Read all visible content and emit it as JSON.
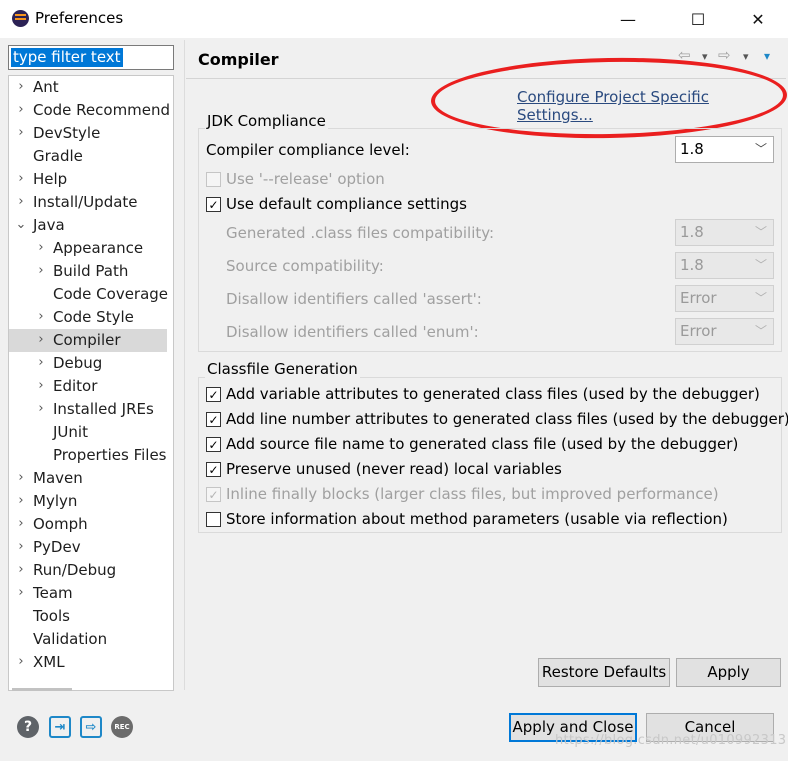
{
  "window": {
    "title": "Preferences",
    "minimize_glyph": "—",
    "maximize_glyph": "☐",
    "close_glyph": "✕"
  },
  "filter": {
    "value": "type filter text"
  },
  "tree": [
    {
      "label": "Ant",
      "expander": "›"
    },
    {
      "label": "Code Recommend",
      "expander": "›"
    },
    {
      "label": "DevStyle",
      "expander": "›"
    },
    {
      "label": "Gradle",
      "expander": ""
    },
    {
      "label": "Help",
      "expander": "›"
    },
    {
      "label": "Install/Update",
      "expander": "›"
    },
    {
      "label": "Java",
      "expander": "⌄"
    },
    {
      "label": "Appearance",
      "expander": "›"
    },
    {
      "label": "Build Path",
      "expander": "›"
    },
    {
      "label": "Code Coverage",
      "expander": ""
    },
    {
      "label": "Code Style",
      "expander": "›"
    },
    {
      "label": "Compiler",
      "expander": "›",
      "selected": true
    },
    {
      "label": "Debug",
      "expander": "›"
    },
    {
      "label": "Editor",
      "expander": "›"
    },
    {
      "label": "Installed JREs",
      "expander": "›"
    },
    {
      "label": "JUnit",
      "expander": ""
    },
    {
      "label": "Properties Files",
      "expander": ""
    },
    {
      "label": "Maven",
      "expander": "›"
    },
    {
      "label": "Mylyn",
      "expander": "›"
    },
    {
      "label": "Oomph",
      "expander": "›"
    },
    {
      "label": "PyDev",
      "expander": "›"
    },
    {
      "label": "Run/Debug",
      "expander": "›"
    },
    {
      "label": "Team",
      "expander": "›"
    },
    {
      "label": "Tools",
      "expander": ""
    },
    {
      "label": "Validation",
      "expander": ""
    },
    {
      "label": "XML",
      "expander": "›"
    }
  ],
  "page": {
    "title": "Compiler",
    "nav": {
      "back": "⇦",
      "back_menu": "▾",
      "forward": "⇨",
      "forward_menu": "▾",
      "view_menu": "▾"
    },
    "configure_link": "Configure Project Specific Settings..."
  },
  "jdk": {
    "group_title": "JDK Compliance",
    "compliance_label": "Compiler compliance level:",
    "compliance_value": "1.8",
    "release_option": {
      "label": "Use '--release' option",
      "checked": false
    },
    "default_settings": {
      "label": "Use default compliance settings",
      "checked": true
    },
    "rows": [
      {
        "label": "Generated .class files compatibility:",
        "value": "1.8"
      },
      {
        "label": "Source compatibility:",
        "value": "1.8"
      },
      {
        "label": "Disallow identifiers called 'assert':",
        "value": "Error"
      },
      {
        "label": "Disallow identifiers called 'enum':",
        "value": "Error"
      }
    ]
  },
  "classfile": {
    "group_title": "Classfile Generation",
    "options": [
      {
        "label": "Add variable attributes to generated class files (used by the debugger)",
        "checked": true
      },
      {
        "label": "Add line number attributes to generated class files (used by the debugger)",
        "checked": true
      },
      {
        "label": "Add source file name to generated class file (used by the debugger)",
        "checked": true
      },
      {
        "label": "Preserve unused (never read) local variables",
        "checked": true
      },
      {
        "label": "Inline finally blocks (larger class files, but improved performance)",
        "checked": true,
        "disabled": true
      },
      {
        "label": "Store information about method parameters (usable via reflection)",
        "checked": false
      }
    ]
  },
  "buttons": {
    "restore_defaults": "Restore Defaults",
    "apply": "Apply",
    "apply_and_close": "Apply and Close",
    "cancel": "Cancel"
  },
  "bottom_icons": {
    "help": "?",
    "import": "⇥",
    "export": "⇨",
    "rec": "REC"
  },
  "watermark": "https://blog.csdn.net/u010992313",
  "colors": {
    "selection": "#0078d7",
    "link": "#2a4a7f",
    "annotation_red": "#ea1f1f",
    "icon_blue": "#1e88c8",
    "icon_gray": "#5f6368"
  }
}
